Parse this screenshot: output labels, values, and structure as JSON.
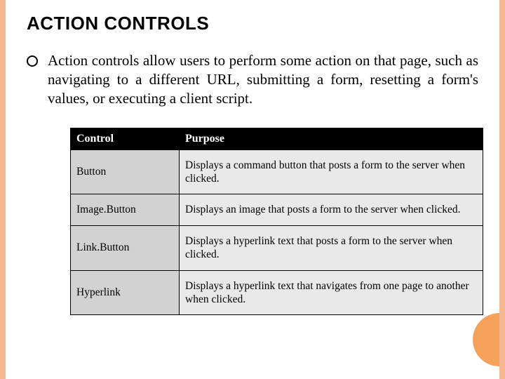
{
  "title": "ACTION CONTROLS",
  "paragraph": "Action controls allow users to perform some action on that page, such as navigating to a different URL, submitting a form, resetting a form's values, or executing a client script.",
  "table": {
    "headers": {
      "col1": "Control",
      "col2": "Purpose"
    },
    "rows": [
      {
        "control": "Button",
        "purpose": "Displays a command button that posts a form to the server when clicked."
      },
      {
        "control": "Image.Button",
        "purpose": "Displays an image that posts a form to the server when clicked."
      },
      {
        "control": "Link.Button",
        "purpose": "Displays a hyperlink text that posts a form to the server when clicked."
      },
      {
        "control": "Hyperlink",
        "purpose": "Displays a hyperlink text that navigates from one page to another when clicked."
      }
    ]
  }
}
